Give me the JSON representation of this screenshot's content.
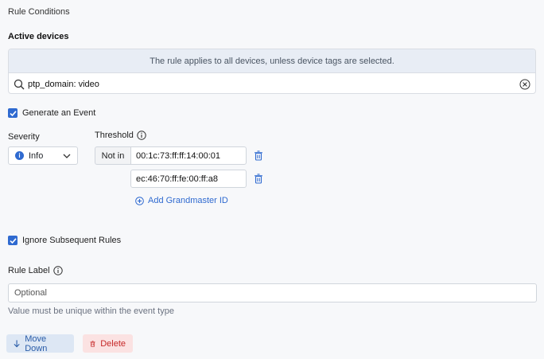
{
  "section_title": "Rule Conditions",
  "active_devices": {
    "title": "Active devices",
    "info": "The rule applies to all devices, unless device tags are selected.",
    "query": "ptp_domain: video"
  },
  "generate_event": {
    "label": "Generate an Event",
    "checked": true
  },
  "severity": {
    "label": "Severity",
    "value": "Info"
  },
  "threshold": {
    "label": "Threshold",
    "operator": "Not in",
    "values": [
      "00:1c:73:ff:ff:14:00:01",
      "ec:46:70:ff:fe:00:ff:a8"
    ],
    "add_label": "Add Grandmaster ID"
  },
  "ignore_subsequent": {
    "label": "Ignore Subsequent Rules",
    "checked": true
  },
  "rule_label": {
    "label": "Rule Label",
    "placeholder": "Optional",
    "hint": "Value must be unique within the event type"
  },
  "buttons": {
    "move_down": "Move Down",
    "delete": "Delete"
  },
  "colors": {
    "accent": "#2f6ad0",
    "danger": "#c62828",
    "danger_bg": "#fbe2e2",
    "info_bg": "#e8edf5"
  }
}
